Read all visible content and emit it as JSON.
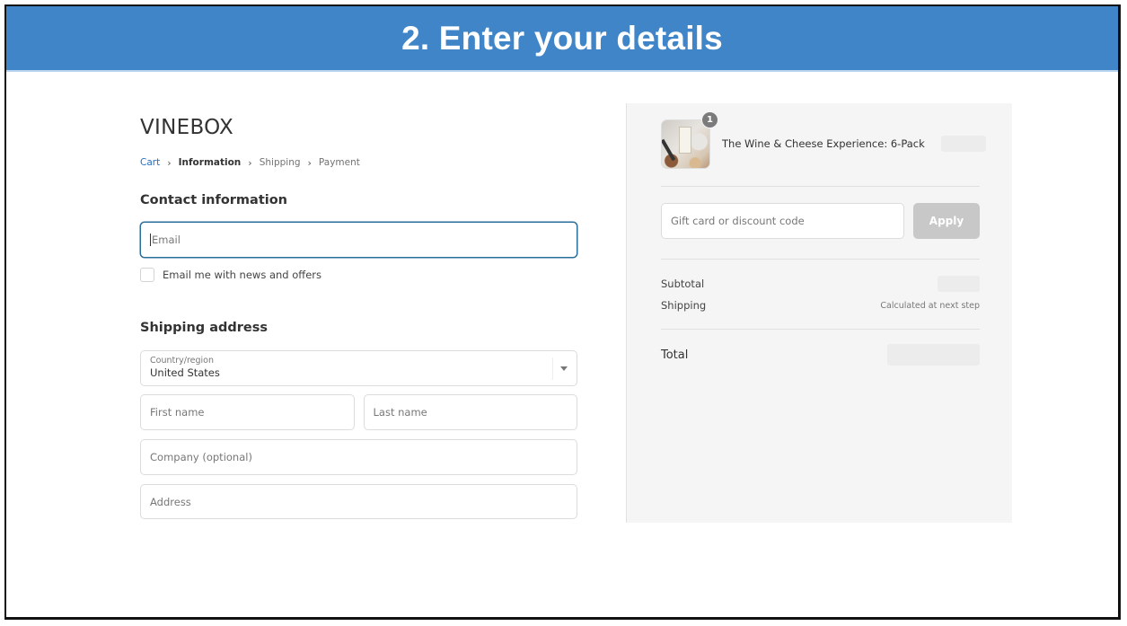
{
  "banner": {
    "title": "2. Enter your details"
  },
  "checkout": {
    "brand": "VINEBOX",
    "breadcrumb": [
      {
        "label": "Cart",
        "state": "link"
      },
      {
        "label": "Information",
        "state": "current"
      },
      {
        "label": "Shipping",
        "state": "upcoming"
      },
      {
        "label": "Payment",
        "state": "upcoming"
      }
    ],
    "contact": {
      "title": "Contact information",
      "email_placeholder": "Email",
      "email_value": "",
      "newsletter_label": "Email me with news and offers",
      "newsletter_checked": false
    },
    "shipping": {
      "title": "Shipping address",
      "country_label": "Country/region",
      "country_value": "United States",
      "first_name_placeholder": "First name",
      "last_name_placeholder": "Last name",
      "company_placeholder": "Company (optional)",
      "address_placeholder": "Address"
    }
  },
  "summary": {
    "product": {
      "name": "The Wine & Cheese Experience: 6-Pack",
      "quantity": "1"
    },
    "discount": {
      "placeholder": "Gift card or discount code",
      "apply_label": "Apply"
    },
    "subtotal_label": "Subtotal",
    "shipping_label": "Shipping",
    "shipping_note": "Calculated at next step",
    "total_label": "Total"
  },
  "colors": {
    "banner": "#3f85c8",
    "link": "#2a6ebb",
    "focus_border": "#2a6e9b",
    "apply_disabled": "#c8c8c8",
    "summary_bg": "#f5f5f5"
  }
}
